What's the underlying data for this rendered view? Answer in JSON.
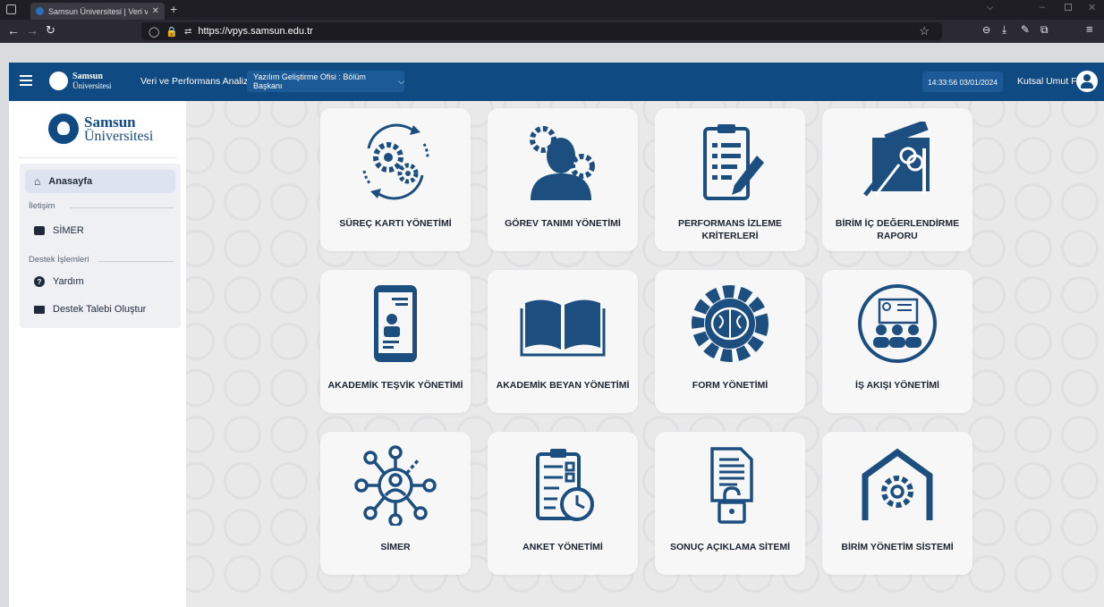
{
  "browser": {
    "tab_title": "Samsun Üniversitesi | Veri ve Pe",
    "new_tab": "+",
    "url": "https://vpys.samsun.edu.tr"
  },
  "header": {
    "logo_line1": "Samsun",
    "logo_line2": "Üniversitesi",
    "app_title": "Veri ve Performans Analizi",
    "unit_select": "Yazılım Geliştirme Ofisi : Bölüm Başkanı",
    "datetime": "14:33:56 03/01/2024",
    "user_name": "Kutsal Umut Fırat"
  },
  "sidebar": {
    "logo_line1": "Samsun",
    "logo_line2": "Üniversitesi",
    "home": "Anasayfa",
    "section_contact": "İletişim",
    "simer": "SİMER",
    "section_support": "Destek İşlemleri",
    "help": "Yardım",
    "support_request": "Destek Talebi Oluştur"
  },
  "cards": [
    {
      "label": "SÜREÇ KARTI YÖNETİMİ",
      "icon": "process-gears-icon"
    },
    {
      "label": "GÖREV TANIMI YÖNETİMİ",
      "icon": "person-gears-icon"
    },
    {
      "label": "PERFORMANS İZLEME KRİTERLERİ",
      "icon": "clipboard-pencil-icon"
    },
    {
      "label": "BİRİM İÇ DEĞERLENDİRME RAPORU",
      "icon": "drafting-tools-icon"
    },
    {
      "label": "AKADEMİK TEŞVİK YÖNETİMİ",
      "icon": "phone-profile-icon"
    },
    {
      "label": "AKADEMİK BEYAN YÖNETİMİ",
      "icon": "open-book-icon"
    },
    {
      "label": "FORM YÖNETİMİ",
      "icon": "brain-gear-icon"
    },
    {
      "label": "İŞ AKIŞI YÖNETİMİ",
      "icon": "team-presentation-icon"
    },
    {
      "label": "SİMER",
      "icon": "network-person-icon"
    },
    {
      "label": "ANKET YÖNETİMİ",
      "icon": "survey-clock-icon"
    },
    {
      "label": "SONUÇ AÇIKLAMA SİTEMİ",
      "icon": "document-lock-icon"
    },
    {
      "label": "BİRİM YÖNETİM SİSTEMİ",
      "icon": "house-gear-icon"
    }
  ],
  "colors": {
    "brand": "#0f4a83",
    "icon": "#1c4f80"
  }
}
